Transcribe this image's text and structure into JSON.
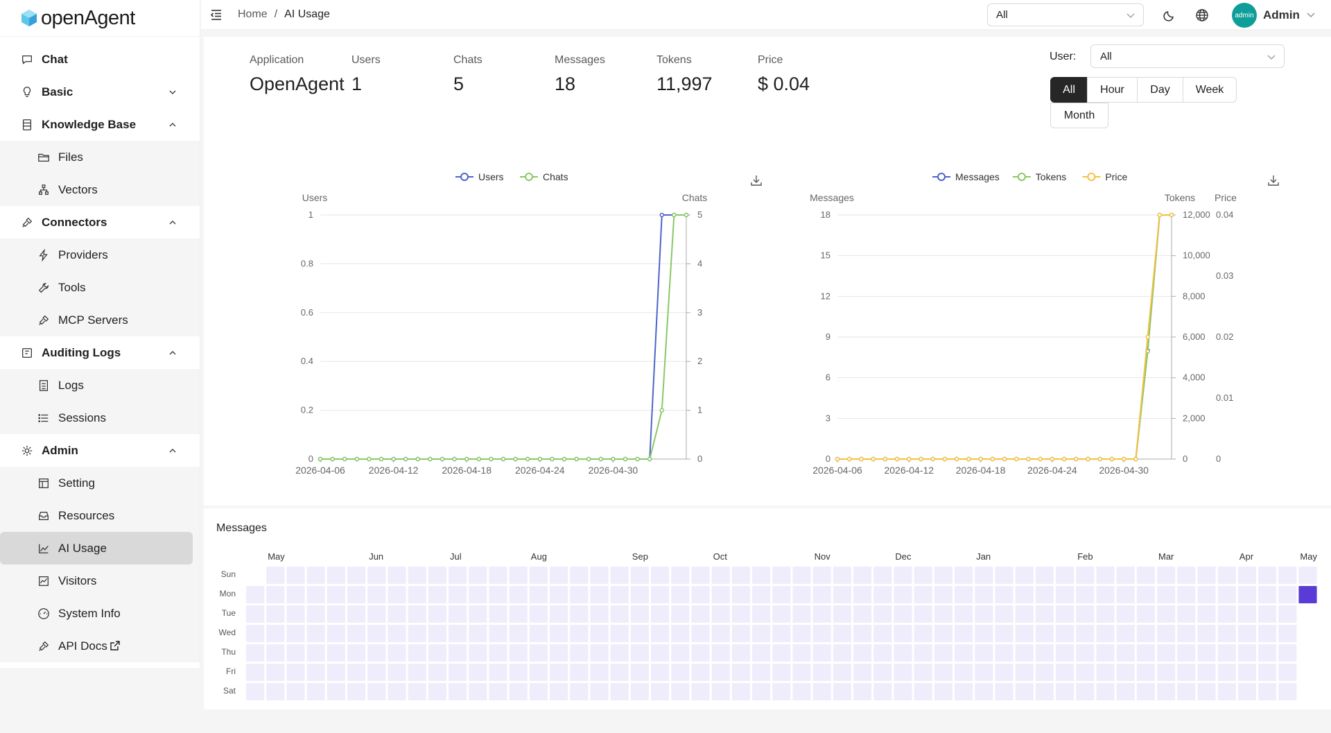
{
  "app": {
    "name": "openAgent"
  },
  "sidebar": {
    "items": [
      {
        "label": "Chat",
        "icon": "chat-icon",
        "top": true
      },
      {
        "label": "Basic",
        "icon": "bulb-icon",
        "top": true,
        "chevron": "down"
      },
      {
        "label": "Knowledge Base",
        "icon": "database-icon",
        "top": true,
        "chevron": "up"
      },
      {
        "label": "Files",
        "icon": "folder-icon",
        "sub": true
      },
      {
        "label": "Vectors",
        "icon": "cluster-icon",
        "sub": true
      },
      {
        "label": "Connectors",
        "icon": "plug-icon",
        "top": true,
        "chevron": "up"
      },
      {
        "label": "Providers",
        "icon": "bolt-icon",
        "sub": true
      },
      {
        "label": "Tools",
        "icon": "tool-icon",
        "sub": true
      },
      {
        "label": "MCP Servers",
        "icon": "plug-icon",
        "sub": true
      },
      {
        "label": "Auditing Logs",
        "icon": "audit-icon",
        "top": true,
        "chevron": "up"
      },
      {
        "label": "Logs",
        "icon": "file-icon",
        "sub": true
      },
      {
        "label": "Sessions",
        "icon": "list-icon",
        "sub": true
      },
      {
        "label": "Admin",
        "icon": "gear-icon",
        "top": true,
        "chevron": "up"
      },
      {
        "label": "Setting",
        "icon": "layout-icon",
        "sub": true
      },
      {
        "label": "Resources",
        "icon": "inbox-icon",
        "sub": true
      },
      {
        "label": "AI Usage",
        "icon": "line-chart-icon",
        "sub": true,
        "active": true
      },
      {
        "label": "Visitors",
        "icon": "stock-icon",
        "sub": true
      },
      {
        "label": "System Info",
        "icon": "dashboard-icon",
        "sub": true
      },
      {
        "label": "API Docs",
        "icon": "plug-icon",
        "sub": true,
        "external": true
      }
    ]
  },
  "header": {
    "breadcrumb": [
      "Home",
      "/",
      "AI Usage"
    ],
    "select_value": "All",
    "user_name": "Admin",
    "avatar_text": "admin"
  },
  "stats": [
    {
      "label": "Application",
      "value": "OpenAgent"
    },
    {
      "label": "Users",
      "value": "1"
    },
    {
      "label": "Chats",
      "value": "5"
    },
    {
      "label": "Messages",
      "value": "18"
    },
    {
      "label": "Tokens",
      "value": "11,997"
    },
    {
      "label": "Price",
      "value": "$ 0.04"
    }
  ],
  "filter": {
    "user_label": "User:",
    "user_value": "All",
    "periods": [
      "All",
      "Hour",
      "Day",
      "Week",
      "Month"
    ],
    "selected_period": "All"
  },
  "colors": {
    "blue": "#4d63c9",
    "green": "#88c866",
    "yellow": "#f4c143",
    "heat_empty": "#efedfc",
    "heat_full": "#5b3bd6"
  },
  "chart_data": [
    {
      "type": "line",
      "legend": [
        "Users",
        "Chats"
      ],
      "x_ticks": [
        "2026-04-06",
        "2026-04-12",
        "2026-04-18",
        "2026-04-24",
        "2026-04-30"
      ],
      "left_axis": {
        "label": "Users",
        "ticks": [
          "0",
          "0.2",
          "0.4",
          "0.6",
          "0.8",
          "1"
        ],
        "ylim": [
          0,
          1
        ]
      },
      "right_axis": {
        "label": "Chats",
        "ticks": [
          "0",
          "1",
          "2",
          "3",
          "4",
          "5"
        ],
        "ylim": [
          0,
          5
        ]
      },
      "series": [
        {
          "name": "Users",
          "axis": "left",
          "color": "#4d63c9",
          "values": [
            0,
            0,
            0,
            0,
            0,
            0,
            0,
            0,
            0,
            0,
            0,
            0,
            0,
            0,
            0,
            0,
            0,
            0,
            0,
            0,
            0,
            0,
            0,
            0,
            0,
            0,
            0,
            0,
            1,
            1,
            1
          ]
        },
        {
          "name": "Chats",
          "axis": "right",
          "color": "#88c866",
          "values": [
            0,
            0,
            0,
            0,
            0,
            0,
            0,
            0,
            0,
            0,
            0,
            0,
            0,
            0,
            0,
            0,
            0,
            0,
            0,
            0,
            0,
            0,
            0,
            0,
            0,
            0,
            0,
            0,
            1,
            5,
            5
          ]
        }
      ]
    },
    {
      "type": "line",
      "legend": [
        "Messages",
        "Tokens",
        "Price"
      ],
      "x_ticks": [
        "2026-04-06",
        "2026-04-12",
        "2026-04-18",
        "2026-04-24",
        "2026-04-30"
      ],
      "left_axis": {
        "label": "Messages",
        "ticks": [
          "0",
          "3",
          "6",
          "9",
          "12",
          "15",
          "18"
        ],
        "ylim": [
          0,
          18
        ]
      },
      "right_axis": {
        "label": "Tokens",
        "ticks": [
          "0",
          "2,000",
          "4,000",
          "6,000",
          "8,000",
          "10,000",
          "12,000"
        ],
        "ylim": [
          0,
          12000
        ]
      },
      "right_axis2": {
        "label": "Price",
        "ticks": [
          "0",
          "0.01",
          "0.02",
          "0.03",
          "0.04"
        ],
        "ylim": [
          0,
          0.04
        ]
      },
      "series": [
        {
          "name": "Messages",
          "axis": "left",
          "color": "#4d63c9",
          "values": [
            0,
            0,
            0,
            0,
            0,
            0,
            0,
            0,
            0,
            0,
            0,
            0,
            0,
            0,
            0,
            0,
            0,
            0,
            0,
            0,
            0,
            0,
            0,
            0,
            0,
            0,
            8,
            18,
            18
          ]
        },
        {
          "name": "Tokens",
          "axis": "right",
          "color": "#88c866",
          "values": [
            0,
            0,
            0,
            0,
            0,
            0,
            0,
            0,
            0,
            0,
            0,
            0,
            0,
            0,
            0,
            0,
            0,
            0,
            0,
            0,
            0,
            0,
            0,
            0,
            0,
            0,
            5300,
            11997,
            11997
          ]
        },
        {
          "name": "Price",
          "axis": "right2",
          "color": "#f4c143",
          "values": [
            0,
            0,
            0,
            0,
            0,
            0,
            0,
            0,
            0,
            0,
            0,
            0,
            0,
            0,
            0,
            0,
            0,
            0,
            0,
            0,
            0,
            0,
            0,
            0,
            0,
            0,
            0.02,
            0.04,
            0.04
          ]
        }
      ]
    },
    {
      "type": "heatmap",
      "title": "Messages",
      "months": [
        "May",
        "Jun",
        "Jul",
        "Aug",
        "Sep",
        "Oct",
        "Nov",
        "Dec",
        "Jan",
        "Feb",
        "Mar",
        "Apr",
        "May"
      ],
      "days": [
        "Sun",
        "Mon",
        "Tue",
        "Wed",
        "Thu",
        "Fri",
        "Sat"
      ],
      "weeks": 53,
      "filled": [
        {
          "week": 52,
          "day": 1,
          "value": 18
        }
      ]
    }
  ]
}
